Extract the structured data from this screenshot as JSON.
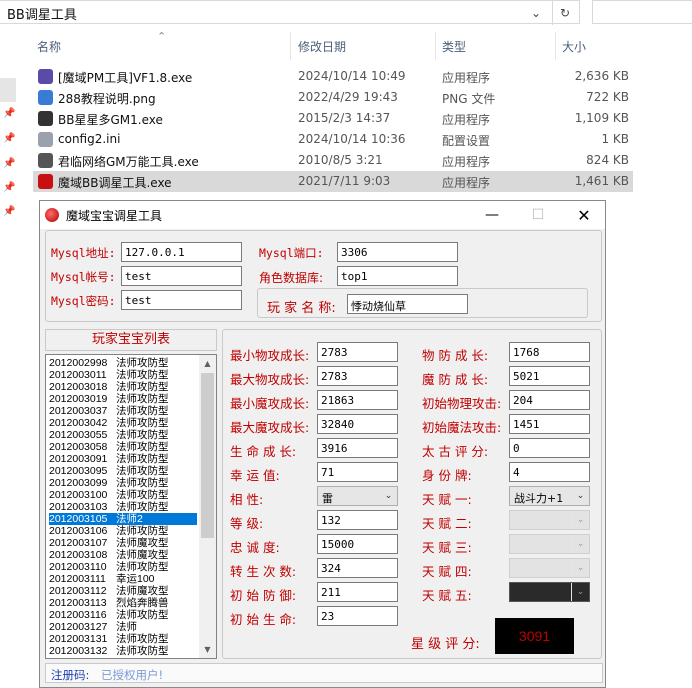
{
  "explorer": {
    "address": "BB调星工具",
    "columns": {
      "name": "名称",
      "date": "修改日期",
      "type": "类型",
      "size": "大小"
    },
    "files": [
      {
        "name": "[魔域PM工具]VF1.8.exe",
        "date": "2024/10/14 10:49",
        "type": "应用程序",
        "size": "2,636 KB",
        "icon": "app-icon",
        "color": "#5b4aa8"
      },
      {
        "name": "288教程说明.png",
        "date": "2022/4/29 19:43",
        "type": "PNG 文件",
        "size": "722 KB",
        "icon": "png-file-icon",
        "color": "#3a7bd5"
      },
      {
        "name": "BB星星多GM1.exe",
        "date": "2015/2/3 14:37",
        "type": "应用程序",
        "size": "1,109 KB",
        "icon": "app-icon",
        "color": "#333333"
      },
      {
        "name": "config2.ini",
        "date": "2024/10/14 10:36",
        "type": "配置设置",
        "size": "1 KB",
        "icon": "ini-file-icon",
        "color": "#9aa3ad"
      },
      {
        "name": "君临网络GM万能工具.exe",
        "date": "2010/8/5 3:21",
        "type": "应用程序",
        "size": "824 KB",
        "icon": "app-icon",
        "color": "#555555"
      },
      {
        "name": "魔域BB调星工具.exe",
        "date": "2021/7/11 9:03",
        "type": "应用程序",
        "size": "1,461 KB",
        "icon": "app-icon",
        "color": "#c81010"
      }
    ]
  },
  "app": {
    "title": "魔域宝宝调星工具",
    "db": {
      "mysql_addr_label": "Mysql地址:",
      "mysql_addr": "127.0.0.1",
      "mysql_port_label": "Mysql端口:",
      "mysql_port": "3306",
      "mysql_user_label": "Mysql帐号:",
      "mysql_user": "test",
      "role_db_label": "角色数据库:",
      "role_db": "top1",
      "mysql_pass_label": "Mysql密码:",
      "mysql_pass": "test",
      "player_name_label": "玩 家 名 称:",
      "player_name": "悸动烧仙草"
    },
    "list_title": "玩家宝宝列表",
    "pets": [
      {
        "id": "2012002998",
        "type": "法师攻防型"
      },
      {
        "id": "2012003011",
        "type": "法师攻防型"
      },
      {
        "id": "2012003018",
        "type": "法师攻防型"
      },
      {
        "id": "2012003019",
        "type": "法师攻防型"
      },
      {
        "id": "2012003037",
        "type": "法师攻防型"
      },
      {
        "id": "2012003042",
        "type": "法师攻防型"
      },
      {
        "id": "2012003055",
        "type": "法师攻防型"
      },
      {
        "id": "2012003058",
        "type": "法师攻防型"
      },
      {
        "id": "2012003091",
        "type": "法师攻防型"
      },
      {
        "id": "2012003095",
        "type": "法师攻防型"
      },
      {
        "id": "2012003099",
        "type": "法师攻防型"
      },
      {
        "id": "2012003100",
        "type": "法师攻防型"
      },
      {
        "id": "2012003103",
        "type": "法师攻防型"
      },
      {
        "id": "2012003105",
        "type": "法师2",
        "selected": true
      },
      {
        "id": "2012003106",
        "type": "法师攻防型"
      },
      {
        "id": "2012003107",
        "type": "法师魔攻型"
      },
      {
        "id": "2012003108",
        "type": "法师魔攻型"
      },
      {
        "id": "2012003110",
        "type": "法师攻防型"
      },
      {
        "id": "2012003111",
        "type": "幸运100"
      },
      {
        "id": "2012003112",
        "type": "法师魔攻型"
      },
      {
        "id": "2012003113",
        "type": "烈焰奔腾兽"
      },
      {
        "id": "2012003116",
        "type": "法师攻防型"
      },
      {
        "id": "2012003127",
        "type": "法师"
      },
      {
        "id": "2012003131",
        "type": "法师攻防型"
      },
      {
        "id": "2012003132",
        "type": "法师攻防型"
      }
    ],
    "stats_left": [
      {
        "label": "最小物攻成长:",
        "value": "2783"
      },
      {
        "label": "最大物攻成长:",
        "value": "2783"
      },
      {
        "label": "最小魔攻成长:",
        "value": "21863"
      },
      {
        "label": "最大魔攻成长:",
        "value": "32840"
      },
      {
        "label": "生 命 成 长:",
        "value": "3916"
      },
      {
        "label": "幸  运  值:",
        "value": "71"
      },
      {
        "label": "相    性:",
        "value": "雷",
        "combo": true
      },
      {
        "label": "等    级:",
        "value": "132"
      },
      {
        "label": "忠  诚  度:",
        "value": "15000"
      },
      {
        "label": "转 生 次 数:",
        "value": "324"
      },
      {
        "label": "初 始 防 御:",
        "value": "211"
      },
      {
        "label": "初 始 生 命:",
        "value": "23"
      }
    ],
    "stats_right": [
      {
        "label": "物 防 成 长:",
        "value": "1768"
      },
      {
        "label": "魔 防 成 长:",
        "value": "5021"
      },
      {
        "label": "初始物理攻击:",
        "value": "204"
      },
      {
        "label": "初始魔法攻击:",
        "value": "1451"
      },
      {
        "label": "太 古 评 分:",
        "value": "0"
      },
      {
        "label": "身  份  牌:",
        "value": "4"
      },
      {
        "label": "天  赋  一:",
        "value": "战斗力+1",
        "combo": true
      },
      {
        "label": "天  赋  二:",
        "value": "",
        "combo": true,
        "disabled": true
      },
      {
        "label": "天  赋  三:",
        "value": "",
        "combo": true,
        "disabled": true
      },
      {
        "label": "天  赋  四:",
        "value": "",
        "combo": true,
        "disabled": true
      },
      {
        "label": "天  赋  五:",
        "value": "",
        "combo": true,
        "disabled": true,
        "dark": true
      }
    ],
    "star_label": "星 级 评 分:",
    "star_value": "3091",
    "reg_label": "注册码:",
    "reg_value": "已授权用户!"
  }
}
